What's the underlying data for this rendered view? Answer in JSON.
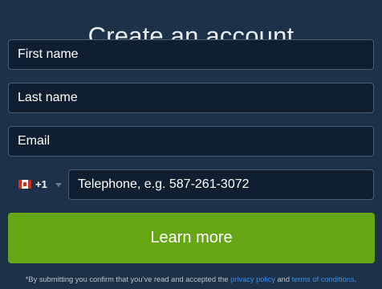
{
  "form": {
    "title": "Create an account",
    "first_name_placeholder": "First name",
    "last_name_placeholder": "Last name",
    "email_placeholder": "Email",
    "phone": {
      "country_flag": "flag-canada-icon",
      "dial_code": "+1",
      "placeholder": "Telephone, e.g. 587-261-3072"
    },
    "submit_label": "Learn more"
  },
  "disclaimer": {
    "text_before": "*By submitting you confirm that you’ve read and accepted the ",
    "privacy_link": "privacy policy",
    "text_middle": " and ",
    "terms_link": "terms of conditions",
    "text_end": "."
  },
  "colors": {
    "background": "#1d3249",
    "field_background": "#0f1f31",
    "field_border": "#4b5f74",
    "button": "#66a614",
    "link": "#3b8fe8"
  }
}
